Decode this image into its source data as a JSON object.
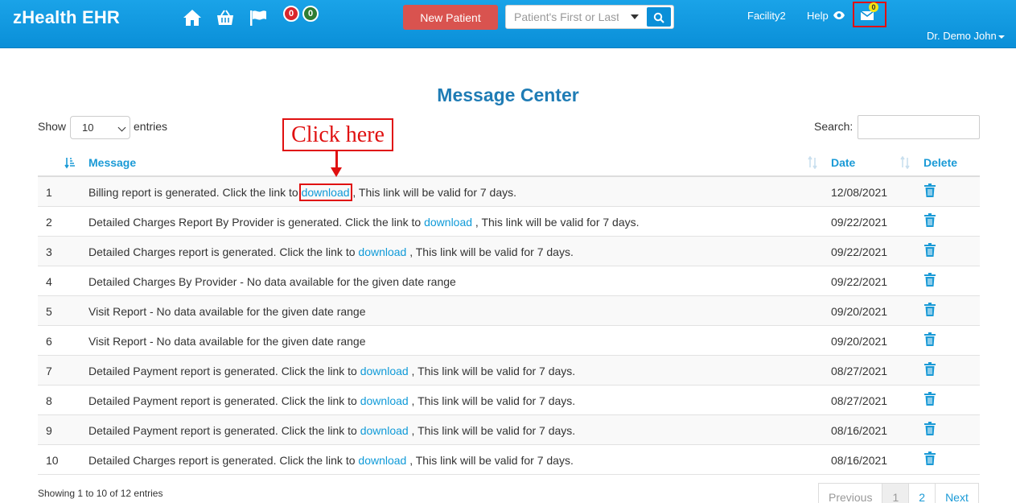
{
  "header": {
    "brand": "zHealth EHR",
    "badges": {
      "red_count": "0",
      "green_count": "0"
    },
    "new_patient_label": "New Patient",
    "patient_search_placeholder": "Patient's First or Last Name",
    "facility": "Facility2",
    "help": "Help",
    "mail_count": "0",
    "user": "Dr. Demo John"
  },
  "icons": [
    "home-icon",
    "basket-icon",
    "flag-icon",
    "eye-icon",
    "envelope-icon",
    "search-icon",
    "trash-icon",
    "sort-icon"
  ],
  "page": {
    "title": "Message Center",
    "show_label": "Show",
    "entries_value": "10",
    "entries_label": "entries",
    "search_label": "Search:"
  },
  "annotation": {
    "callout": "Click here"
  },
  "table": {
    "columns": {
      "message": "Message",
      "date": "Date",
      "delete": "Delete"
    },
    "link_text": "download",
    "rows": [
      {
        "num": "1",
        "pre": "Billing report is generated. Click the link to ",
        "link": "download",
        "post": " , This link will be valid for 7 days.",
        "date": "12/08/2021"
      },
      {
        "num": "2",
        "pre": "Detailed Charges Report By Provider is generated. Click the link to ",
        "link": "download",
        "post": " , This link will be valid for 7 days.",
        "date": "09/22/2021"
      },
      {
        "num": "3",
        "pre": "Detailed Charges report is generated. Click the link to ",
        "link": "download",
        "post": " , This link will be valid for 7 days.",
        "date": "09/22/2021"
      },
      {
        "num": "4",
        "pre": "Detailed Charges By Provider - No data available for the given date range",
        "link": "",
        "post": "",
        "date": "09/22/2021"
      },
      {
        "num": "5",
        "pre": "Visit Report - No data available for the given date range",
        "link": "",
        "post": "",
        "date": "09/20/2021"
      },
      {
        "num": "6",
        "pre": "Visit Report - No data available for the given date range",
        "link": "",
        "post": "",
        "date": "09/20/2021"
      },
      {
        "num": "7",
        "pre": "Detailed Payment report is generated. Click the link to ",
        "link": "download",
        "post": " , This link will be valid for 7 days.",
        "date": "08/27/2021"
      },
      {
        "num": "8",
        "pre": "Detailed Payment report is generated. Click the link to ",
        "link": "download",
        "post": " , This link will be valid for 7 days.",
        "date": "08/27/2021"
      },
      {
        "num": "9",
        "pre": "Detailed Payment report is generated. Click the link to ",
        "link": "download",
        "post": " , This link will be valid for 7 days.",
        "date": "08/16/2021"
      },
      {
        "num": "10",
        "pre": "Detailed Charges report is generated. Click the link to ",
        "link": "download",
        "post": " , This link will be valid for 7 days.",
        "date": "08/16/2021"
      }
    ]
  },
  "footer": {
    "showing": "Showing 1 to 10 of 12 entries",
    "previous": "Previous",
    "pages": [
      "1",
      "2"
    ],
    "next": "Next"
  },
  "colors": {
    "header_blue": "#0a8fd8",
    "title_blue": "#1f7cb5",
    "link_blue": "#0f9ad8",
    "danger": "#d9534f",
    "annotation_red": "#e01010"
  }
}
